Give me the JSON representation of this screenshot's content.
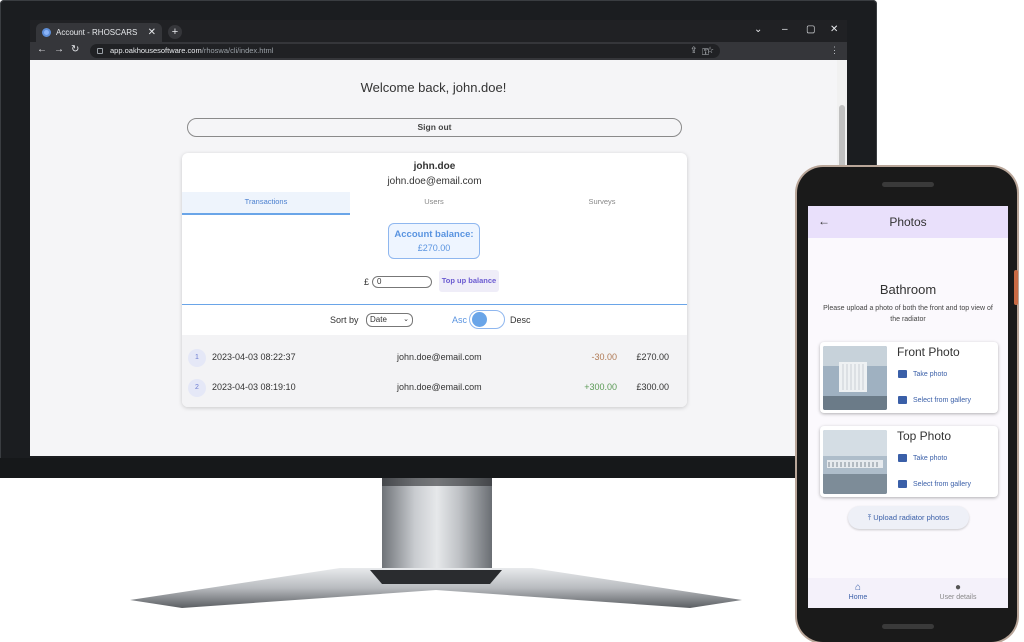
{
  "browser": {
    "tab_title": "Account - RHOSCARS",
    "tab_close": "✕",
    "new_tab": "+",
    "url_host": "app.oakhousesoftware.com",
    "url_path": "/rhoswa/cli/index.html"
  },
  "web": {
    "welcome": "Welcome back, john.doe!",
    "sign_out": "Sign out",
    "username": "john.doe",
    "email": "john.doe@email.com",
    "tabs": [
      "Transactions",
      "Users",
      "Surveys"
    ],
    "active_tab": "Transactions",
    "balance_label": "Account balance:",
    "balance_value": "£270.00",
    "currency_symbol": "£",
    "topup_value": "0",
    "topup_button": "Top up balance",
    "sort_by": "Sort by",
    "sort_value": "Date",
    "asc": "Asc",
    "desc": "Desc",
    "transactions": [
      {
        "num": "1",
        "date": "2023-04-03 08:22:37",
        "email": "john.doe@email.com",
        "amount": "-30.00",
        "balance": "£270.00"
      },
      {
        "num": "2",
        "date": "2023-04-03 08:19:10",
        "email": "john.doe@email.com",
        "amount": "+300.00",
        "balance": "£300.00"
      }
    ]
  },
  "mobile": {
    "title": "Photos",
    "room": "Bathroom",
    "instructions": "Please upload a photo of both the front and top view of the radiator",
    "cards": [
      {
        "title": "Front Photo",
        "take": "Take photo",
        "gallery": "Select from gallery"
      },
      {
        "title": "Top Photo",
        "take": "Take photo",
        "gallery": "Select from gallery"
      }
    ],
    "upload_button": "Upload radiator photos",
    "nav": [
      "Home",
      "User details"
    ]
  },
  "colors": {
    "accent_blue": "#5a94e0",
    "negative": "#b07a55",
    "positive": "#5a9a55",
    "appbar": "#e9e0fb"
  }
}
